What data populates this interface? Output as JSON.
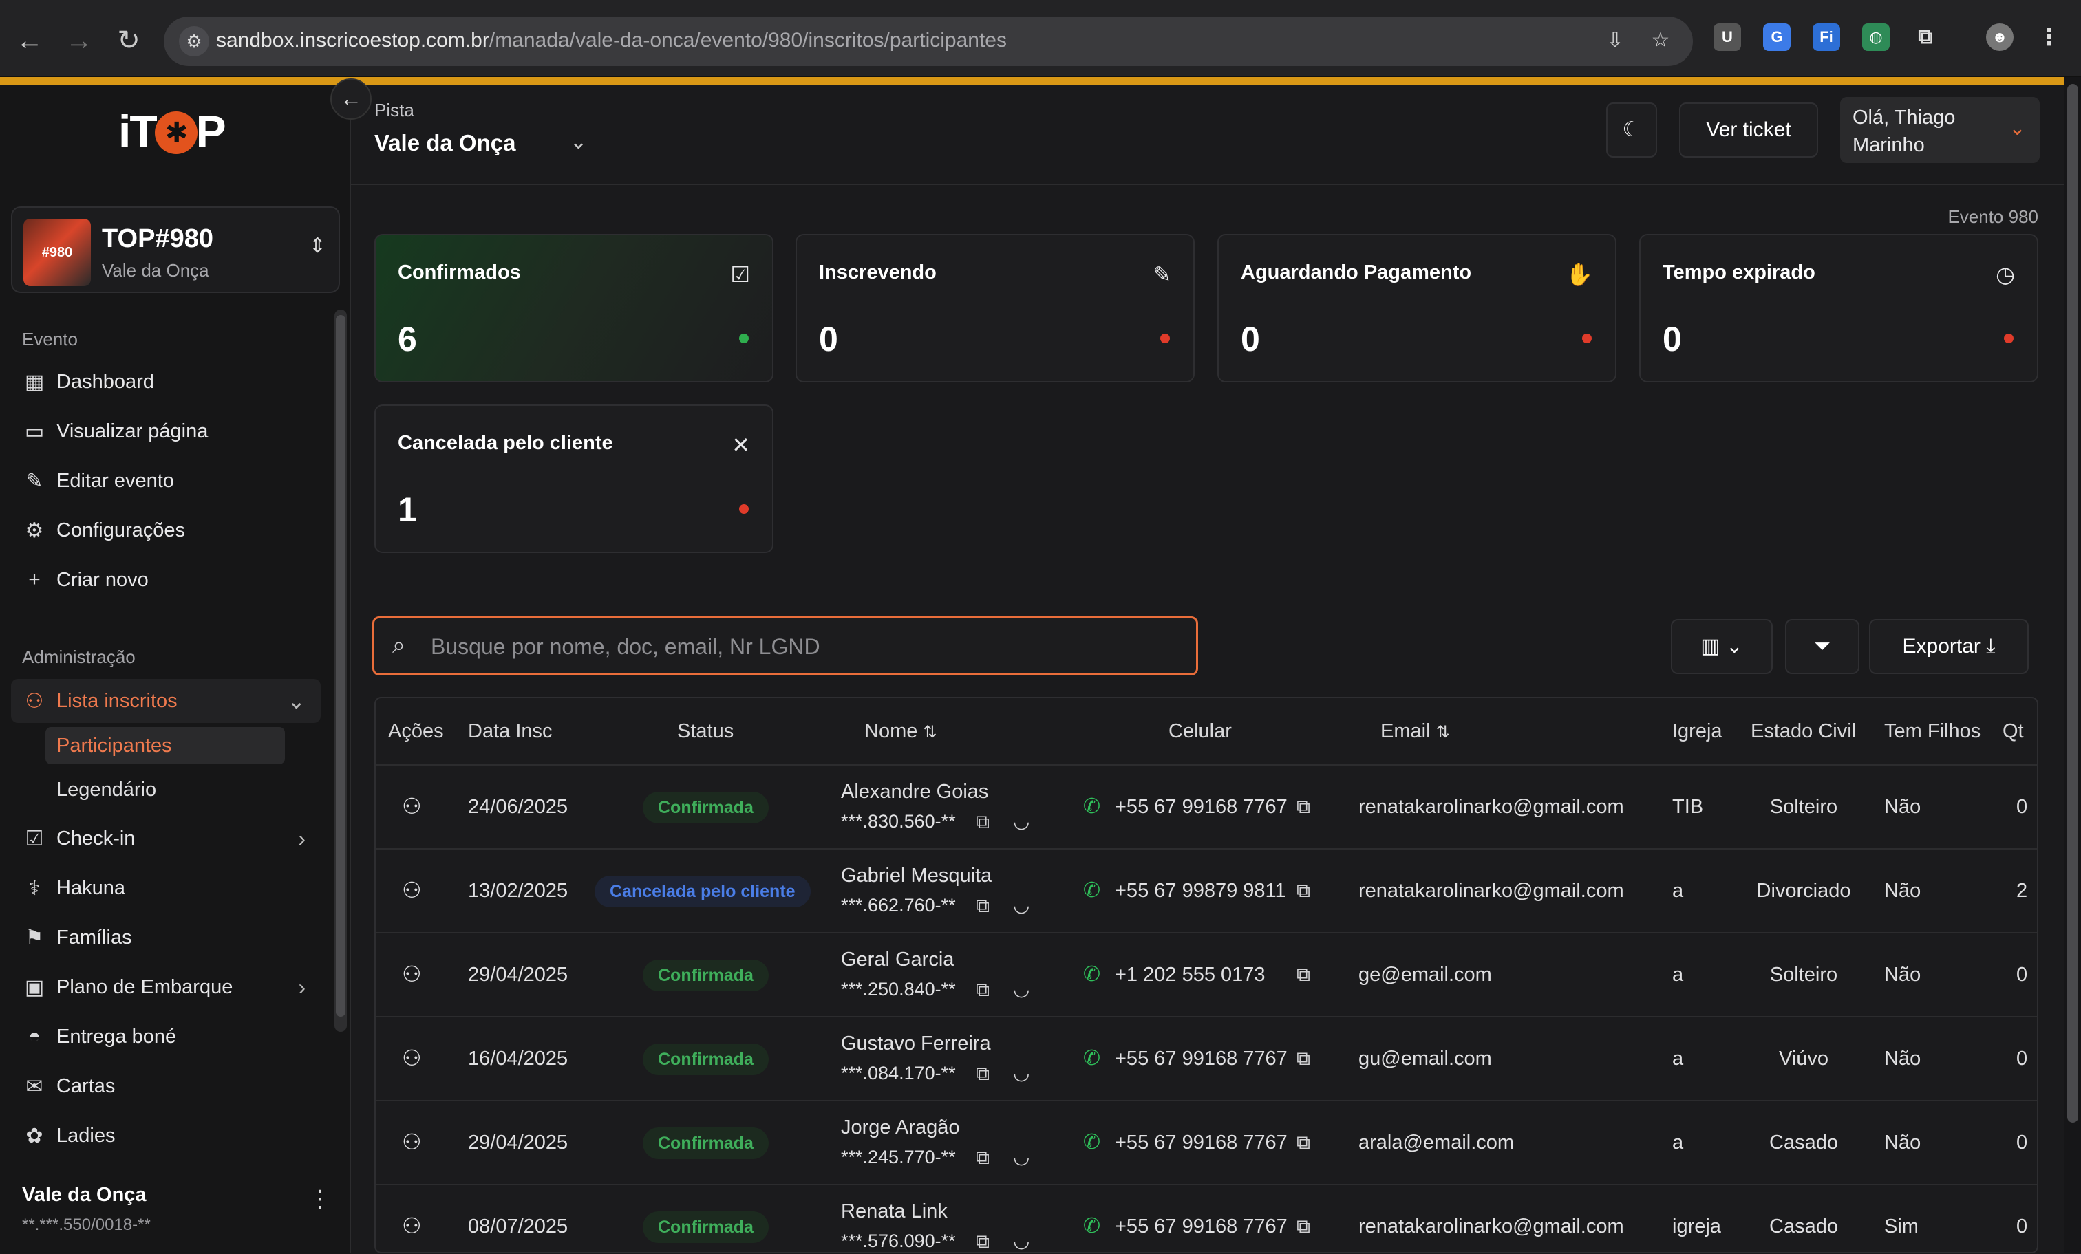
{
  "browser": {
    "url_host": "sandbox.inscricoestop.com.br",
    "url_path": "/manada/vale-da-onca/evento/980/inscritos/participantes"
  },
  "sidebar": {
    "logo_text": "iTOP",
    "event": {
      "title": "TOP#980",
      "subtitle": "Vale da Onça",
      "thumb_text": "#980"
    },
    "section_evento": "Evento",
    "items_evento": [
      {
        "label": "Dashboard",
        "icon": "grid-icon"
      },
      {
        "label": "Visualizar página",
        "icon": "browser-window-icon"
      },
      {
        "label": "Editar evento",
        "icon": "pencil-icon"
      },
      {
        "label": "Configurações",
        "icon": "gear-icon"
      },
      {
        "label": "Criar novo",
        "icon": "plus-icon"
      }
    ],
    "section_admin": "Administração",
    "lista_inscritos": "Lista inscritos",
    "sub_items": [
      "Participantes",
      "Legendário"
    ],
    "items_admin": [
      {
        "label": "Check-in",
        "icon": "checkbox-icon",
        "chevron": true
      },
      {
        "label": "Hakuna",
        "icon": "stethoscope-icon",
        "chevron": false
      },
      {
        "label": "Famílias",
        "icon": "flag-icon",
        "chevron": false
      },
      {
        "label": "Plano de Embarque",
        "icon": "bus-icon",
        "chevron": true
      },
      {
        "label": "Entrega boné",
        "icon": "cap-icon",
        "chevron": false
      },
      {
        "label": "Cartas",
        "icon": "mail-icon",
        "chevron": false
      },
      {
        "label": "Ladies",
        "icon": "flower-icon",
        "chevron": false
      }
    ],
    "footer": {
      "name": "Vale da Onça",
      "doc": "**.***.550/0018-**"
    }
  },
  "header": {
    "label": "Pista",
    "value": "Vale da Onça",
    "ver_ticket": "Ver ticket",
    "user_line1": "Olá, Thiago",
    "user_line2": "Marinho"
  },
  "event_number": "Evento 980",
  "cards": [
    {
      "title": "Confirmados",
      "value": "6",
      "icon": "check-square-icon",
      "dot": "#2fae4e"
    },
    {
      "title": "Inscrevendo",
      "value": "0",
      "icon": "edit-icon",
      "dot": "#e03b2a"
    },
    {
      "title": "Aguardando Pagamento",
      "value": "0",
      "icon": "hand-coins-icon",
      "dot": "#e03b2a"
    },
    {
      "title": "Tempo expirado",
      "value": "0",
      "icon": "clock-icon",
      "dot": "#e03b2a"
    },
    {
      "title": "Cancelada pelo cliente",
      "value": "1",
      "icon": "close-icon",
      "dot": "#e03b2a"
    }
  ],
  "search": {
    "placeholder": "Busque por nome, doc, email, Nr LGND"
  },
  "toolbar": {
    "export_label": "Exportar"
  },
  "table": {
    "headers": {
      "acoes": "Ações",
      "data": "Data Insc",
      "status": "Status",
      "nome": "Nome",
      "celular": "Celular",
      "email": "Email",
      "igreja": "Igreja",
      "estado": "Estado Civil",
      "filhos": "Tem Filhos",
      "qt": "Qt"
    },
    "rows": [
      {
        "data": "24/06/2025",
        "status": "Confirmada",
        "status_type": "ok",
        "nome": "Alexandre Goias",
        "doc": "***.830.560-**",
        "celular": "+55 67 99168 7767",
        "email": "renatakarolinarko@gmail.com",
        "igreja": "TIB",
        "estado": "Solteiro",
        "filhos": "Não",
        "qt": "0"
      },
      {
        "data": "13/02/2025",
        "status": "Cancelada pelo cliente",
        "status_type": "cancel",
        "nome": "Gabriel Mesquita",
        "doc": "***.662.760-**",
        "celular": "+55 67 99879 9811",
        "email": "renatakarolinarko@gmail.com",
        "igreja": "a",
        "estado": "Divorciado",
        "filhos": "Não",
        "qt": "2"
      },
      {
        "data": "29/04/2025",
        "status": "Confirmada",
        "status_type": "ok",
        "nome": "Geral Garcia",
        "doc": "***.250.840-**",
        "celular": "+1 202 555 0173",
        "email": "ge@email.com",
        "igreja": "a",
        "estado": "Solteiro",
        "filhos": "Não",
        "qt": "0"
      },
      {
        "data": "16/04/2025",
        "status": "Confirmada",
        "status_type": "ok",
        "nome": "Gustavo Ferreira",
        "doc": "***.084.170-**",
        "celular": "+55 67 99168 7767",
        "email": "gu@email.com",
        "igreja": "a",
        "estado": "Viúvo",
        "filhos": "Não",
        "qt": "0"
      },
      {
        "data": "29/04/2025",
        "status": "Confirmada",
        "status_type": "ok",
        "nome": "Jorge Aragão",
        "doc": "***.245.770-**",
        "celular": "+55 67 99168 7767",
        "email": "arala@email.com",
        "igreja": "a",
        "estado": "Casado",
        "filhos": "Não",
        "qt": "0"
      },
      {
        "data": "08/07/2025",
        "status": "Confirmada",
        "status_type": "ok",
        "nome": "Renata Link",
        "doc": "***.576.090-**",
        "celular": "+55 67 99168 7767",
        "email": "renatakarolinarko@gmail.com",
        "igreja": "igreja",
        "estado": "Casado",
        "filhos": "Sim",
        "qt": "0"
      }
    ]
  }
}
